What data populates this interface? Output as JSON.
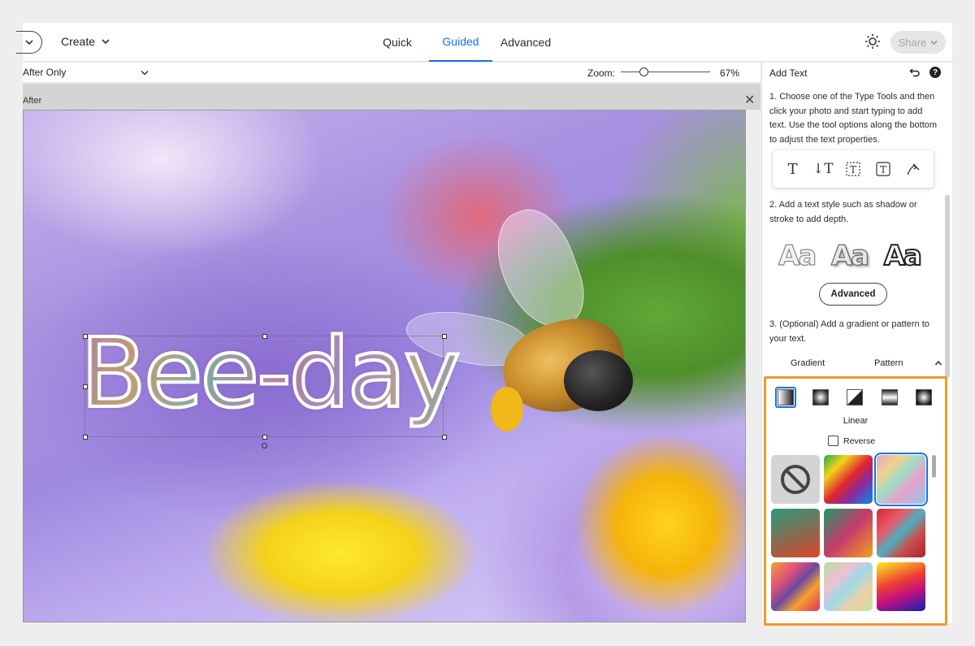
{
  "header": {
    "create_label": "Create",
    "tabs": [
      {
        "label": "Quick",
        "active": false
      },
      {
        "label": "Guided",
        "active": true
      },
      {
        "label": "Advanced",
        "active": false
      }
    ],
    "share_label": "Share"
  },
  "viewbar": {
    "view_mode": "After Only",
    "zoom_label": "Zoom:",
    "zoom_value": "67%",
    "zoom_level": 0.25
  },
  "canvas": {
    "label": "After",
    "overlay_text": "Bee-day"
  },
  "panel": {
    "title": "Add Text",
    "step1": "1. Choose one of the Type Tools and then click your photo and start typing to add text. Use the tool options along the bottom to adjust the text properties.",
    "type_tools": [
      "horizontal-type-icon",
      "vertical-type-icon",
      "text-on-selection-icon",
      "text-on-shape-icon",
      "text-on-path-icon"
    ],
    "step2": "2. Add a text style such as shadow or stroke to add depth.",
    "style_sample": "Aa",
    "advanced_label": "Advanced",
    "step3": "3. (Optional) Add a gradient or pattern to your text.",
    "gradient_tab": "Gradient",
    "pattern_tab": "Pattern",
    "gradient_types": [
      "Linear",
      "Radial",
      "Angle",
      "Reflected",
      "Diamond"
    ],
    "selected_gradient_type": "Linear",
    "reverse_label": "Reverse",
    "reverse_checked": false
  },
  "colors": {
    "accent": "#1473e6",
    "highlight_box": "#f0992c"
  }
}
